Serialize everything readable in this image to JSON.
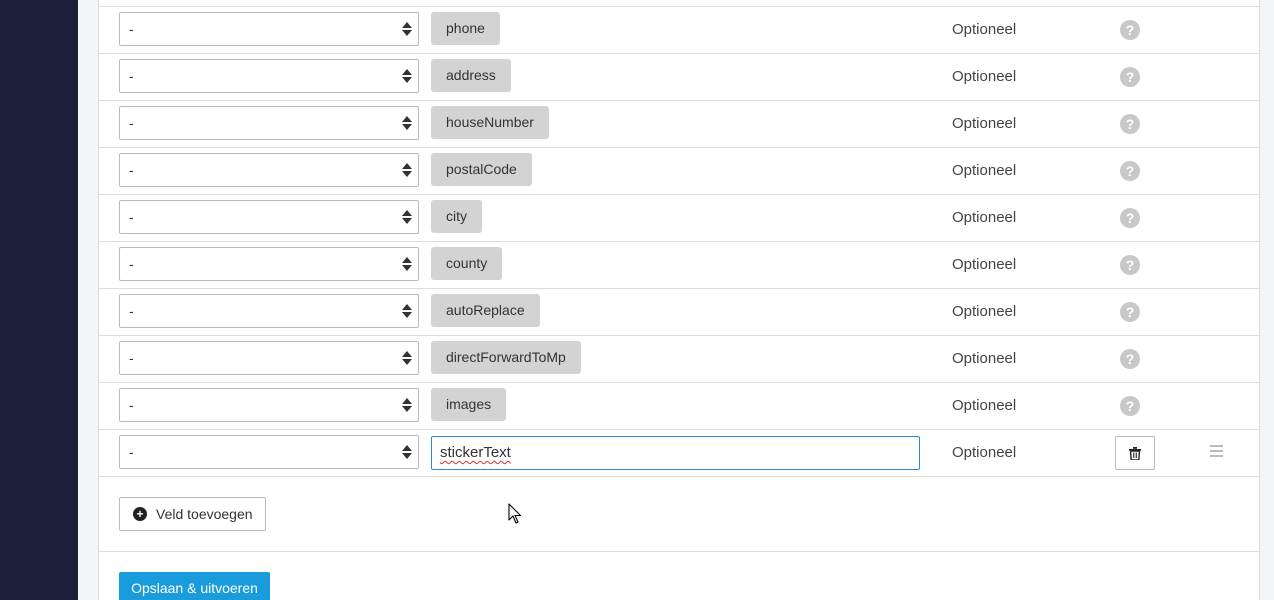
{
  "rows": [
    {
      "mapping": "-",
      "field": "phone",
      "status": "Optioneel",
      "help": "?"
    },
    {
      "mapping": "-",
      "field": "address",
      "status": "Optioneel",
      "help": "?"
    },
    {
      "mapping": "-",
      "field": "houseNumber",
      "status": "Optioneel",
      "help": "?"
    },
    {
      "mapping": "-",
      "field": "postalCode",
      "status": "Optioneel",
      "help": "?"
    },
    {
      "mapping": "-",
      "field": "city",
      "status": "Optioneel",
      "help": "?"
    },
    {
      "mapping": "-",
      "field": "county",
      "status": "Optioneel",
      "help": "?"
    },
    {
      "mapping": "-",
      "field": "autoReplace",
      "status": "Optioneel",
      "help": "?"
    },
    {
      "mapping": "-",
      "field": "directForwardToMp",
      "status": "Optioneel",
      "help": "?"
    },
    {
      "mapping": "-",
      "field": "images",
      "status": "Optioneel",
      "help": "?"
    }
  ],
  "custom_row": {
    "mapping": "-",
    "field_value": "stickerText",
    "status": "Optioneel"
  },
  "add_field_button": "Veld toevoegen",
  "add_field_icon": "+",
  "save_button": "Opslaan & uitvoeren"
}
